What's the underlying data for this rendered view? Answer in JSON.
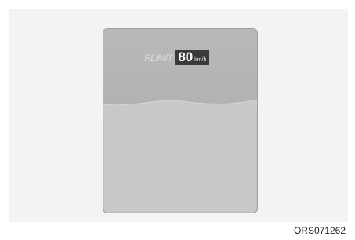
{
  "cluster": {
    "limit_label": "RLIMIT",
    "speed_value": "80",
    "speed_unit": "km/h"
  },
  "figure_code": "ORS071262"
}
